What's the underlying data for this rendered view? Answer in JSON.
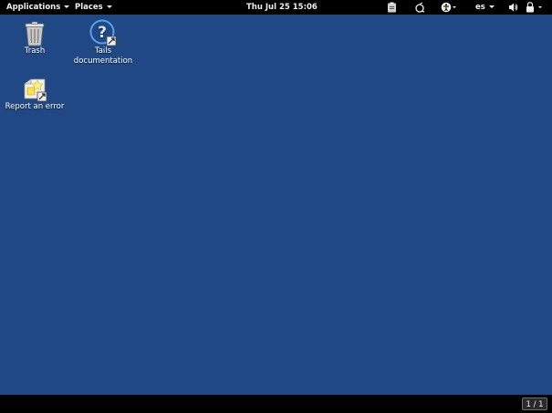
{
  "topbar": {
    "applications_label": "Applications",
    "places_label": "Places",
    "clock": "Thu Jul 25  15:06",
    "keyboard_layout": "es"
  },
  "desktop": {
    "icons": [
      {
        "label": "Trash",
        "icon": "trash-icon"
      },
      {
        "label": "Tails documentation",
        "icon": "help-icon"
      },
      {
        "label": "Report an error",
        "icon": "bug-report-icon"
      }
    ]
  },
  "bottombar": {
    "workspace": "1 / 1"
  },
  "colors": {
    "desktop_background": "#1f4884",
    "panel": "#000000"
  }
}
